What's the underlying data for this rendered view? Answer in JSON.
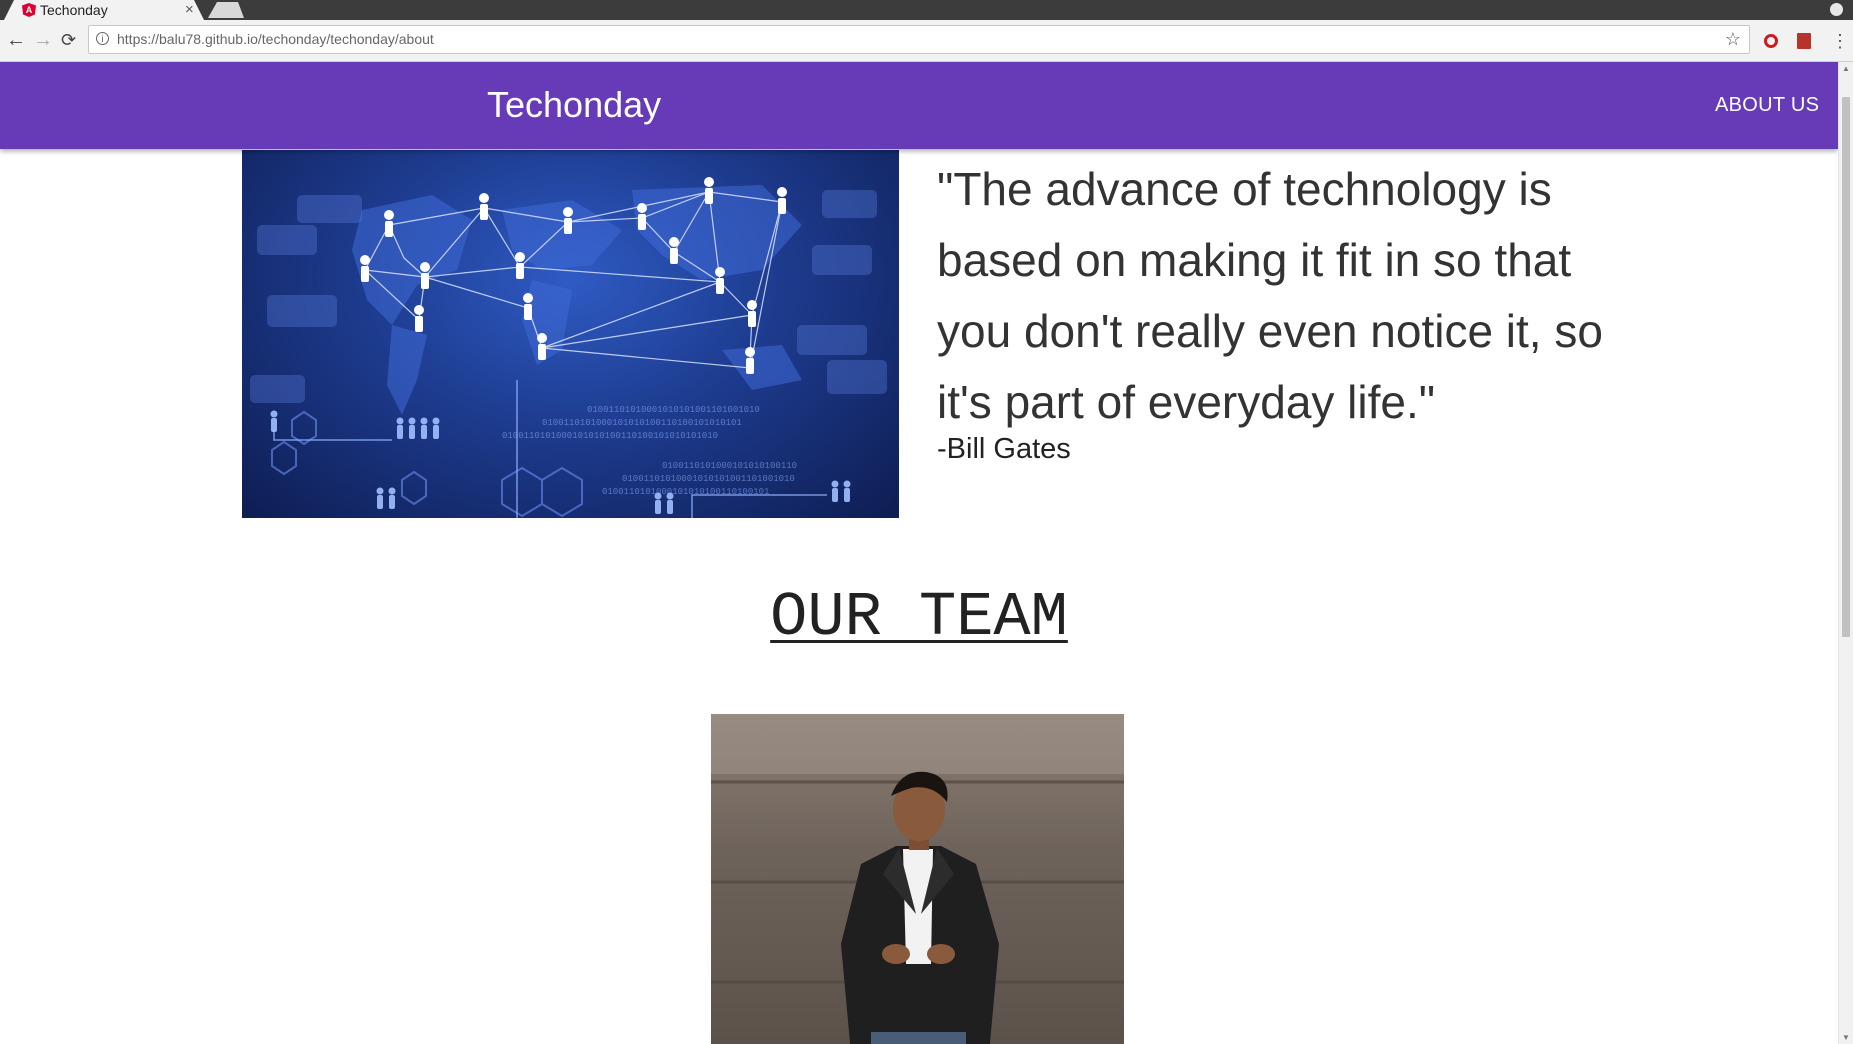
{
  "browser": {
    "tab_title": "Techonday",
    "tab_close": "×",
    "url": "https://balu78.github.io/techonday/techonday/about"
  },
  "navbar": {
    "brand": "Techonday",
    "links": [
      "ABOUT US"
    ]
  },
  "hero": {
    "image_alt": "global technology network",
    "quote": "\"The advance of technology is based on making it fit in so that you don't really even notice it, so it's part of everyday life.\"",
    "author": "-Bill Gates"
  },
  "team": {
    "heading": "OUR TEAM",
    "member_photo_alt": "team member photo"
  },
  "colors": {
    "appbar": "#673ab7",
    "text": "#333333"
  }
}
